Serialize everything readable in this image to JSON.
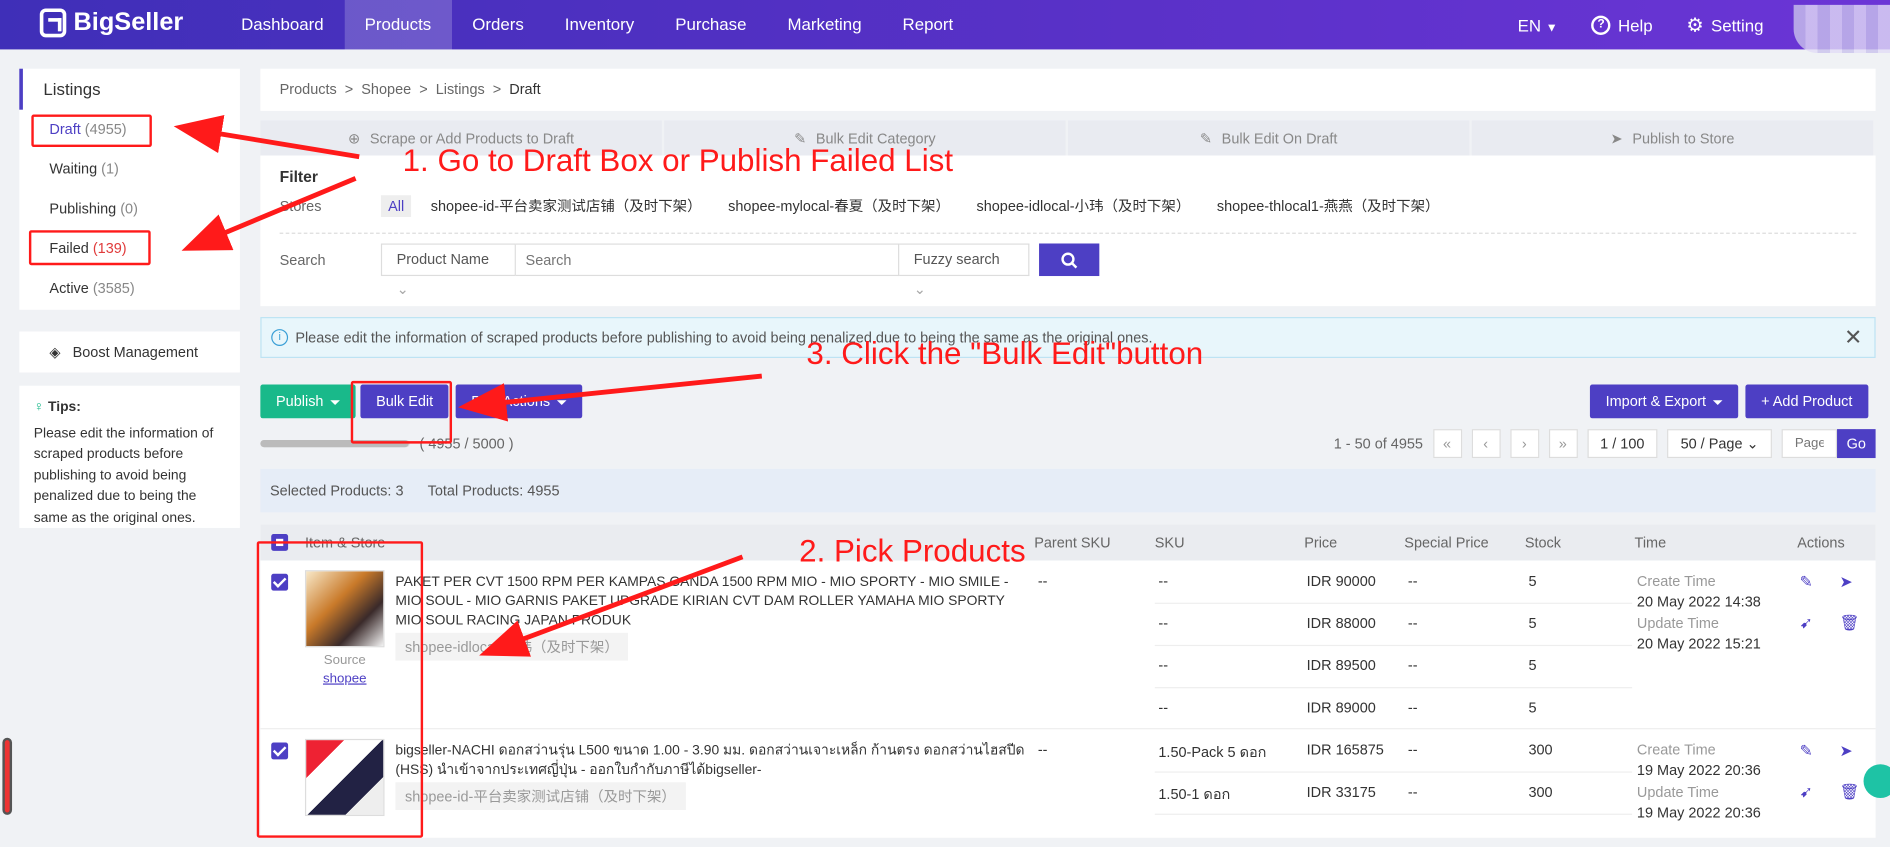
{
  "brand": "BigSeller",
  "nav": [
    "Dashboard",
    "Products",
    "Orders",
    "Inventory",
    "Purchase",
    "Marketing",
    "Report"
  ],
  "top_right": {
    "lang": "EN",
    "help": "Help",
    "setting": "Setting"
  },
  "sidebar": {
    "title": "Listings",
    "items": [
      {
        "label": "Draft",
        "count": "(4955)"
      },
      {
        "label": "Waiting",
        "count": "(1)"
      },
      {
        "label": "Publishing",
        "count": "(0)"
      },
      {
        "label": "Failed",
        "count": "(139)"
      },
      {
        "label": "Active",
        "count": "(3585)"
      }
    ],
    "boost": "Boost Management",
    "tips_title": "Tips:",
    "tips_text": "Please edit the information of scraped products before publishing to avoid being penalized due to being the same as the original ones."
  },
  "breadcrumb": [
    "Products",
    ">",
    "Shopee",
    ">",
    "Listings",
    ">",
    "Draft"
  ],
  "steps": [
    "Scrape or Add Products to Draft",
    "Bulk Edit Category",
    "Bulk Edit On Draft",
    "Publish to Store"
  ],
  "filter": {
    "title": "Filter",
    "stores_label": "Stores",
    "stores": [
      "All",
      "shopee-id-平台卖家测试店铺（及时下架）",
      "shopee-mylocal-春夏（及时下架）",
      "shopee-idlocal-小玮（及时下架）",
      "shopee-thlocal1-燕燕（及时下架）"
    ],
    "search_label": "Search",
    "search_field": "Product Name",
    "search_placeholder": "Search",
    "search_mode": "Fuzzy search"
  },
  "info_bar": "Please edit the information of scraped products before publishing to avoid being penalized due to being the same as the original ones.",
  "toolbar": {
    "publish": "Publish",
    "bulk_edit": "Bulk Edit",
    "bulk_actions": "Bulk Actions",
    "import_export": "Import & Export",
    "add_product": "+ Add Product"
  },
  "pager": {
    "progress_text": "( 4955 / 5000 )",
    "progress_fraction": 0.991,
    "range": "1 - 50 of 4955",
    "page": "1 / 100",
    "per_page": "50 / Page",
    "page_placeholder": "Page",
    "go": "Go"
  },
  "selection": {
    "selected": "Selected Products: 3",
    "total": "Total Products: 4955"
  },
  "table": {
    "headers": [
      "Item & Store",
      "Parent SKU",
      "SKU",
      "Price",
      "Special Price",
      "Stock",
      "Time",
      "Actions"
    ],
    "rows": [
      {
        "title": "PAKET PER CVT 1500 RPM PER KAMPAS GANDA 1500 RPM MIO - MIO SPORTY - MIO SMILE - MIO SOUL - MIO GARNIS PAKET UPGRADE KIRIAN CVT DAM ROLLER YAMAHA MIO SPORTY MIO SOUL RACING JAPAN PRODUK",
        "store": "shopee-idlocal-小玮（及时下架）",
        "source_label": "Source",
        "source": "shopee",
        "parent_sku": "--",
        "skus": [
          "--",
          "--",
          "--",
          "--"
        ],
        "prices": [
          "IDR 90000",
          "IDR 88000",
          "IDR 89500",
          "IDR 89000"
        ],
        "special": [
          "--",
          "--",
          "--",
          "--"
        ],
        "stock": [
          "5",
          "5",
          "5",
          "5"
        ],
        "create_label": "Create Time",
        "create": "20 May 2022 14:38",
        "update_label": "Update Time",
        "update": "20 May 2022 15:21"
      },
      {
        "title": "bigseller-NACHI ดอกสว่านรุ่น L500 ขนาด 1.00 - 3.90 มม. ดอกสว่านเจาะเหล็ก ก้านตรง ดอกสว่านไฮสปีด (HSS) นำเข้าจากประเทศญี่ปุ่น - ออกใบกำกับภาษีได้bigseller-",
        "store": "shopee-id-平台卖家测试店铺（及时下架）",
        "parent_sku": "--",
        "skus": [
          "1.50-Pack 5 ดอก",
          "1.50-1 ดอก"
        ],
        "prices": [
          "IDR 165875",
          "IDR 33175"
        ],
        "special": [
          "--",
          "--"
        ],
        "stock": [
          "300",
          "300"
        ],
        "create_label": "Create Time",
        "create": "19 May 2022 20:36",
        "update_label": "Update Time",
        "update": "19 May 2022 20:36"
      }
    ]
  },
  "annotations": {
    "a1": "1. Go to Draft Box or Publish Failed List",
    "a2": "2. Pick Products",
    "a3": "3. Click the \"Bulk Edit\"button"
  },
  "colors": {
    "brand": "#4d3fc4",
    "green": "#19b98a",
    "annotation": "#ff1a1a"
  }
}
